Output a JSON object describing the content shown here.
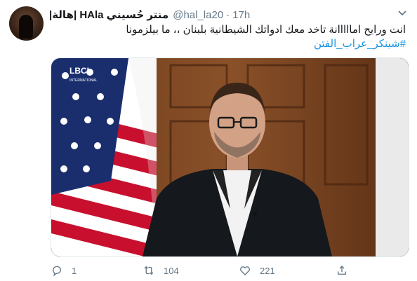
{
  "tweet": {
    "display_name": "منتر حُسيني HAla |هالة|",
    "handle": "@hal_la20",
    "separator": "·",
    "time": "17h",
    "text": "انت ورايح امااااانة تاخد معك ادواتك الشيطانية بلبنان ،، ما بيلزمونا",
    "hashtag": "#شينكر_عراب_الفتن",
    "media": {
      "channel_logo": "LBCI",
      "channel_logo_sub": "INTERNATIONAL"
    },
    "actions": {
      "reply_count": "1",
      "retweet_count": "104",
      "like_count": "221"
    }
  },
  "icons": {
    "reply": "reply-icon",
    "retweet": "retweet-icon",
    "like": "heart-icon",
    "share": "share-icon",
    "menu": "chevron-down-icon"
  },
  "colors": {
    "link": "#1b95e0",
    "secondary_text": "#657786",
    "border": "#e1e8ed"
  }
}
